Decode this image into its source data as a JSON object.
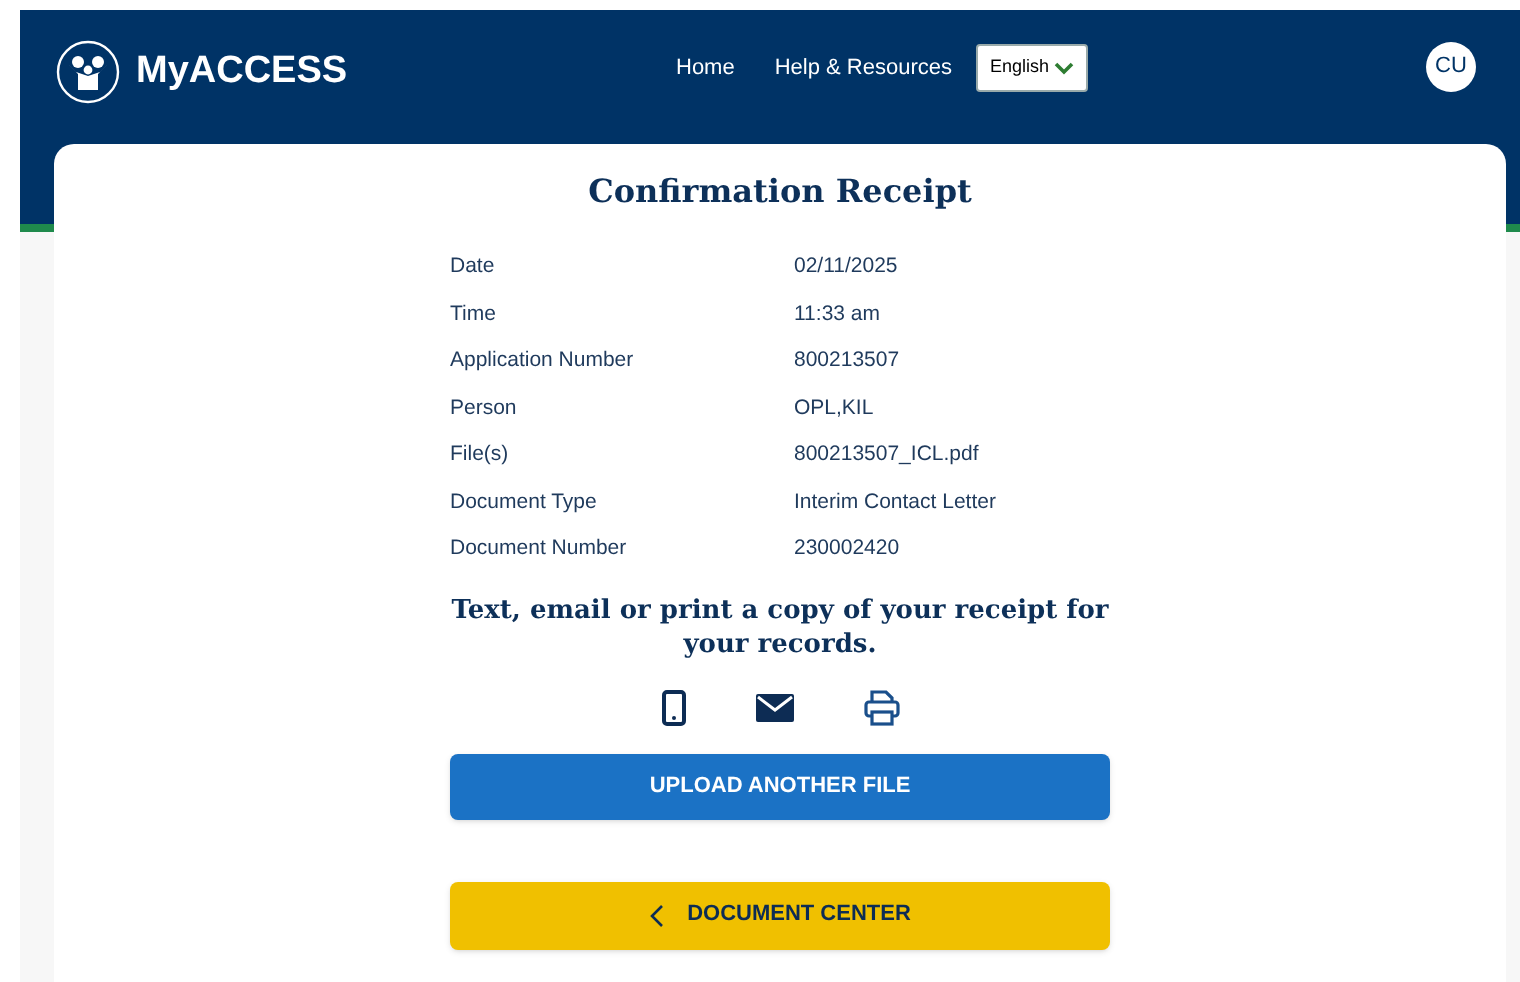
{
  "header": {
    "brand": "MyACCESS",
    "nav": [
      "Home",
      "Help & Resources"
    ],
    "language": "English",
    "avatar": "CU"
  },
  "title": "Confirmation Receipt",
  "details": [
    {
      "label": "Date",
      "value": "02/11/2025"
    },
    {
      "label": "Time",
      "value": "11:33 am"
    },
    {
      "label": "Application Number",
      "value": "800213507"
    },
    {
      "label": "Person",
      "value": "OPL,KIL"
    },
    {
      "label": "File(s)",
      "value": "800213507_ICL.pdf"
    },
    {
      "label": "Document Type",
      "value": "Interim Contact Letter"
    },
    {
      "label": "Document Number",
      "value": "230002420"
    }
  ],
  "share_prompt": "Text, email or print a copy of your receipt for your records.",
  "share_options": [
    {
      "kind": "phone"
    },
    {
      "kind": "email"
    },
    {
      "kind": "print"
    }
  ],
  "buttons": [
    {
      "kind": "primary",
      "label": "UPLOAD ANOTHER FILE"
    },
    {
      "kind": "back",
      "label": "DOCUMENT CENTER"
    }
  ]
}
